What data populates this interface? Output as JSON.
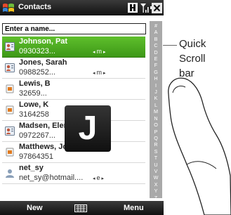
{
  "titlebar": {
    "title": "Contacts"
  },
  "search": {
    "placeholder": "Enter a name..."
  },
  "contacts": [
    {
      "name": "Johnson, Pat",
      "detail": "0930323...",
      "flag": "m",
      "selected": true
    },
    {
      "name": "Jones, Sarah",
      "detail": "0988252...",
      "flag": "m",
      "selected": false
    },
    {
      "name": "Lewis, B",
      "detail": "32659...",
      "flag": "",
      "selected": false
    },
    {
      "name": "Lowe, K",
      "detail": "3164258",
      "flag": "",
      "selected": false
    },
    {
      "name": "Madsen, Elen",
      "detail": "0972267...",
      "flag": "m",
      "selected": false
    },
    {
      "name": "Matthews, Jo",
      "detail": "97864351",
      "flag": "",
      "selected": false
    },
    {
      "name": "net_sy",
      "detail": "net_sy@hotmail....",
      "flag": "e",
      "selected": false
    }
  ],
  "quick_scroll": {
    "letters": [
      "#",
      "A",
      "B",
      "C",
      "D",
      "E",
      "F",
      "G",
      "H",
      "I",
      "J",
      "K",
      "L",
      "M",
      "N",
      "O",
      "P",
      "Q",
      "R",
      "S",
      "T",
      "U",
      "V",
      "W",
      "X",
      "Y",
      "Z"
    ]
  },
  "popup_letter": "J",
  "softkeys": {
    "left": "New",
    "right": "Menu"
  },
  "callout": {
    "line1": "Quick",
    "line2": "Scroll",
    "line3": "bar"
  },
  "icons": {
    "start": "windows-flag-icon",
    "status": [
      "connectivity-icon",
      "signal-icon",
      "volume-icon"
    ],
    "close": "close-icon",
    "keyboard": "keyboard-icon"
  },
  "colors": {
    "selected_row": "#4fae22",
    "title_bar": "#1e1e1e",
    "scroll_bar": "#a9a9a9"
  }
}
